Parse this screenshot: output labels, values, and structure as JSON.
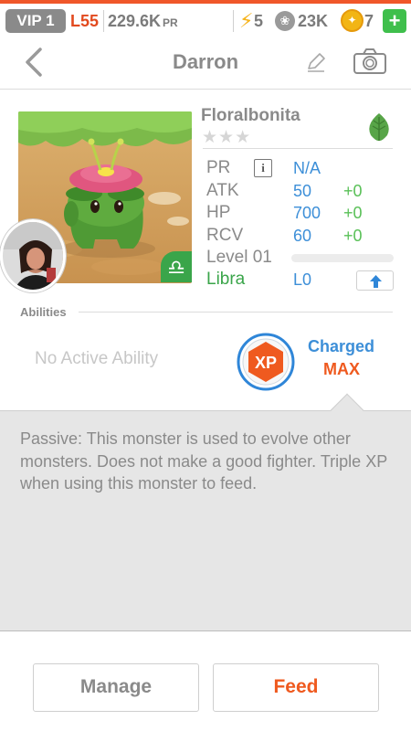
{
  "status_bar": {
    "vip": "VIP 1",
    "level": "L55",
    "pr_value": "229.6K",
    "pr_unit": "PR",
    "energy": "5",
    "paw_count": "23K",
    "coins": "7",
    "add_label": "+"
  },
  "header": {
    "title": "Darron"
  },
  "monster": {
    "name": "Floralbonita",
    "stars": "★★★",
    "element_icon": "leaf-icon",
    "stats": {
      "pr": {
        "label": "PR",
        "value": "N/A"
      },
      "atk": {
        "label": "ATK",
        "value": "50",
        "bonus": "+0"
      },
      "hp": {
        "label": "HP",
        "value": "700",
        "bonus": "+0"
      },
      "rcv": {
        "label": "RCV",
        "value": "60",
        "bonus": "+0"
      },
      "level": {
        "label": "Level 01",
        "progress": 0
      },
      "sign": {
        "label": "Libra",
        "value": "L0"
      }
    }
  },
  "abilities": {
    "section_label": "Abilities",
    "active": "No Active Ability",
    "xp_badge": "XP",
    "charged_label": "Charged",
    "charged_value": "MAX",
    "passive_text": "Passive: This monster is used to evolve other monsters. Does not make a good fighter. Triple XP when using this monster to feed."
  },
  "actions": {
    "manage": "Manage",
    "feed": "Feed"
  },
  "colors": {
    "accent_orange": "#ef5a1f",
    "stat_blue": "#3d8fd8",
    "bonus_green": "#59c057",
    "libra_green": "#3aa54a"
  }
}
